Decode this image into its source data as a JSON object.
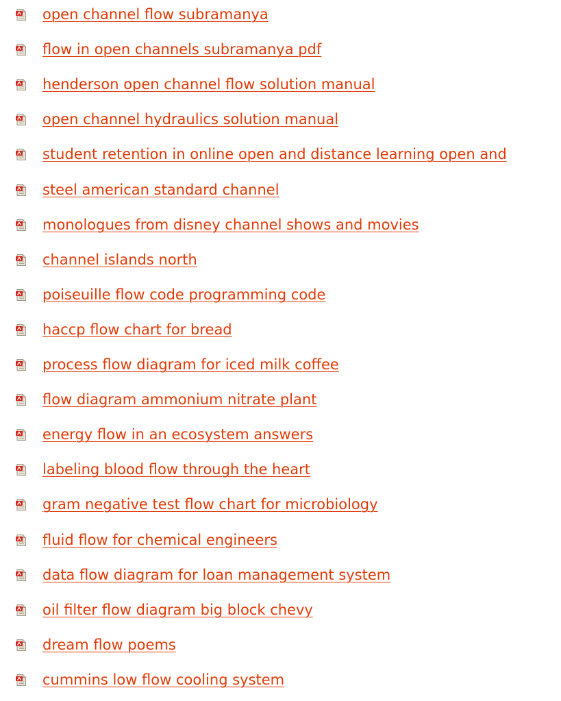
{
  "colors": {
    "link": "#e23a06",
    "pdf_icon_red": "#d8231b",
    "pdf_icon_page": "#e9e4d6"
  },
  "icon_name": "pdf-file-icon",
  "links": [
    "open channel flow subramanya",
    "flow in open channels subramanya pdf",
    "henderson open channel flow solution manual",
    "open channel hydraulics solution manual",
    "student retention in online open and distance learning open and",
    "steel american standard channel",
    "monologues from disney channel shows and movies",
    "channel islands north",
    "poiseuille flow code programming code",
    "haccp flow chart for bread",
    "process flow diagram for iced milk coffee",
    "flow diagram ammonium nitrate plant",
    "energy flow in an ecosystem answers",
    "labeling blood flow through the heart",
    "gram negative test flow chart for microbiology",
    "fluid flow for chemical engineers",
    "data flow diagram for loan management system",
    "oil filter flow diagram big block chevy",
    "dream flow poems",
    "cummins low flow cooling system"
  ]
}
